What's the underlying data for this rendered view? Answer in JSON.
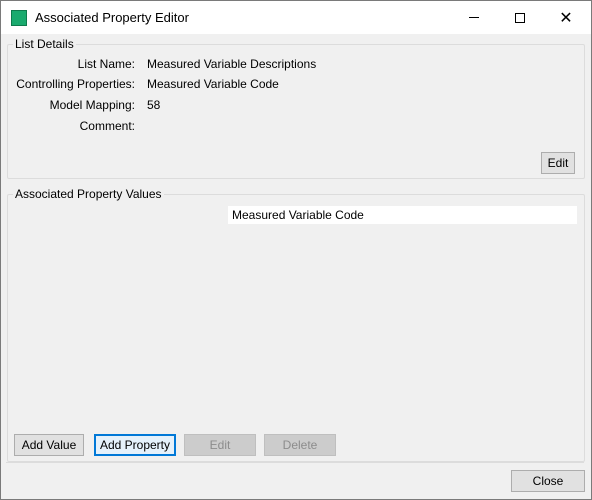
{
  "window": {
    "title": "Associated Property Editor"
  },
  "list_details": {
    "group_label": "List Details",
    "fields": [
      {
        "label": "List Name:",
        "value": "Measured Variable Descriptions"
      },
      {
        "label": "Controlling Properties:",
        "value": "Measured Variable Code"
      },
      {
        "label": "Model Mapping:",
        "value": "58"
      },
      {
        "label": "Comment:",
        "value": ""
      }
    ],
    "edit_label": "Edit"
  },
  "values": {
    "group_label": "Associated Property Values",
    "columns": [
      "Measured Variable Code"
    ],
    "rows": []
  },
  "buttons": {
    "add_value": "Add Value",
    "add_property": "Add Property",
    "edit": "Edit",
    "delete": "Delete",
    "close": "Close"
  },
  "colors": {
    "app_icon": "#1aaa6e",
    "focus_border": "#0078d7"
  },
  "icons": {
    "app": "app-icon",
    "minimize": "minimize-icon",
    "maximize": "maximize-icon",
    "close": "close-icon"
  }
}
